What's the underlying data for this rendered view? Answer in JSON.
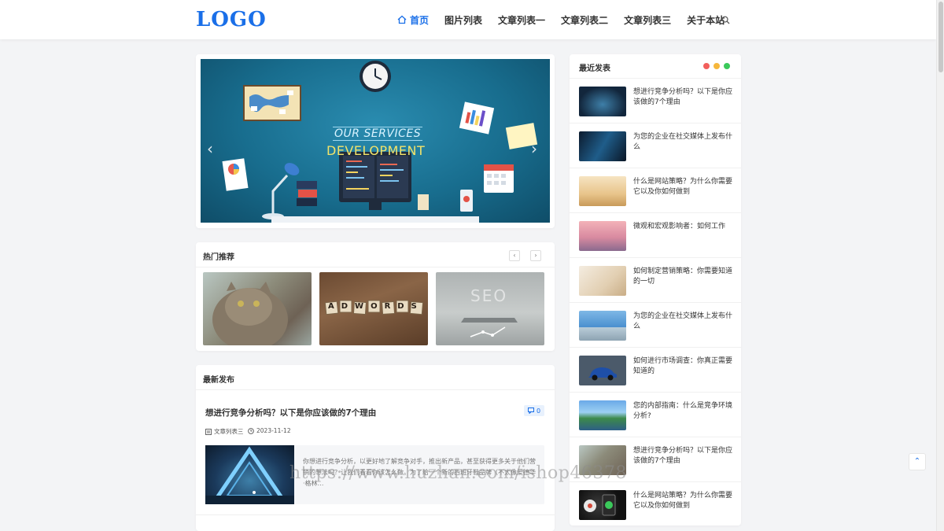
{
  "header": {
    "logo": "LOGO",
    "nav": [
      {
        "label": "首页",
        "active": true
      },
      {
        "label": "图片列表",
        "active": false
      },
      {
        "label": "文章列表一",
        "active": false
      },
      {
        "label": "文章列表二",
        "active": false
      },
      {
        "label": "文章列表三",
        "active": false
      },
      {
        "label": "关于本站",
        "active": false
      }
    ],
    "search_icon": "search-icon",
    "accent_color": "#1a6fe8"
  },
  "slider": {
    "title_line1": "OUR SERVICES",
    "title_line2": "DEVELOPMENT",
    "prev_icon": "‹",
    "next_icon": "›"
  },
  "hot": {
    "title": "热门推荐",
    "prev": "‹",
    "next": "›",
    "thumb_text_2": "ADWORDS",
    "thumb_text_3": "SEO"
  },
  "latest": {
    "title": "最新发布",
    "post": {
      "title": "想进行竞争分析吗？以下是你应该做的7个理由",
      "comments": "0",
      "category": "文章列表三",
      "date": "2023-11-12",
      "excerpt": "你想进行竞争分析，以更好地了解竞争对手，推出新产品，甚至获得更多关于他们营销的想法吗？让我们看看你该怎么做。为了给一个新的西班牙鞋品牌（不太像爱德华·格林…"
    }
  },
  "recent": {
    "title": "最近发表",
    "dot_colors": [
      "#f25f5c",
      "#f6b73c",
      "#3bc95b"
    ],
    "items": [
      {
        "title": "想进行竞争分析吗？以下是你应该做的7个理由"
      },
      {
        "title": "为您的企业在社交媒体上发布什么"
      },
      {
        "title": "什么是网站策略？为什么你需要它以及你如何做到"
      },
      {
        "title": "微观和宏观影响者：如何工作"
      },
      {
        "title": "如何制定营销策略：你需要知道的一切"
      },
      {
        "title": "为您的企业在社交媒体上发布什么"
      },
      {
        "title": "如何进行市场调查：你真正需要知道的"
      },
      {
        "title": "您的内部指南：什么是竞争环境分析?"
      },
      {
        "title": "想进行竞争分析吗？以下是你应该做的7个理由"
      },
      {
        "title": "什么是网站策略？为什么你需要它以及你如何做到"
      }
    ]
  },
  "back_to_top": "⌃",
  "watermark": "https://www.huzhan.com/ishop46378"
}
